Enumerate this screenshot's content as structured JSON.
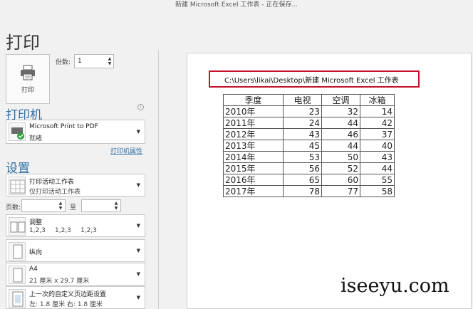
{
  "window": {
    "title": "新建 Microsoft Excel 工作表 - 正在保存..."
  },
  "page_title": "打印",
  "print_button": {
    "label": "打印",
    "icon": "printer-icon"
  },
  "copies": {
    "label": "份数:",
    "value": "1"
  },
  "printer": {
    "section": "打印机",
    "name": "Microsoft Print to PDF",
    "status": "就绪",
    "properties_link": "打印机属性"
  },
  "settings": {
    "section": "设置",
    "scope": {
      "title": "打印活动工作表",
      "sub": "仅打印活动工作表"
    },
    "pages": {
      "label": "页数:",
      "to_label": "至",
      "from_value": "",
      "to_value": ""
    },
    "collate": {
      "title": "调整",
      "sub1": "1,2,3",
      "sub2": "1,2,3",
      "sub3": "1,2,3"
    },
    "orientation": {
      "title": "纵向"
    },
    "paper": {
      "title": "A4",
      "sub": "21 厘米 x 29.7 厘米"
    },
    "margins": {
      "title": "上一次的自定义页边距设置",
      "sub": "左: 1.8 厘米    右: 1.8 厘米"
    }
  },
  "preview": {
    "path": "C:\\Users\\likai\\Desktop\\新建 Microsoft Excel 工作表",
    "table": {
      "headers": [
        "季度",
        "电视",
        "空调",
        "冰箱"
      ],
      "rows": [
        [
          "2010年",
          "23",
          "32",
          "14"
        ],
        [
          "2011年",
          "24",
          "44",
          "42"
        ],
        [
          "2012年",
          "43",
          "46",
          "37"
        ],
        [
          "2013年",
          "45",
          "44",
          "40"
        ],
        [
          "2014年",
          "53",
          "50",
          "43"
        ],
        [
          "2015年",
          "56",
          "52",
          "44"
        ],
        [
          "2016年",
          "65",
          "60",
          "55"
        ],
        [
          "2017年",
          "78",
          "77",
          "58"
        ]
      ]
    }
  },
  "watermark": "iseeyu.com",
  "colors": {
    "accent": "#2f6fa7",
    "highlight_border": "#c8102e"
  }
}
